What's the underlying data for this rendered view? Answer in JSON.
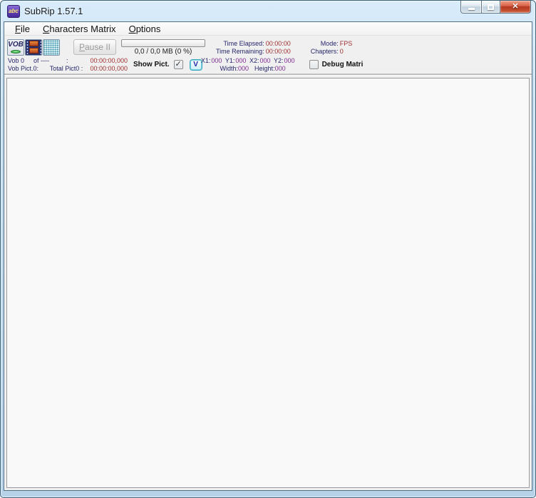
{
  "colors": {
    "label_navy": "#26266b",
    "value_red": "#a03030",
    "value_purple": "#7c2a8e",
    "close_button_red": "#b53922",
    "frame_blue": "#b5d2e9"
  },
  "window": {
    "title": "SubRip 1.57.1",
    "icon_text": "abc"
  },
  "menu": {
    "items": [
      {
        "label": "File"
      },
      {
        "label": "Characters Matrix"
      },
      {
        "label": "Options"
      }
    ]
  },
  "toolbar": {
    "vob_icon_text": "VOB",
    "pause_label": "Pause II",
    "progress_text": "0,0 / 0,0 MB (0 %)",
    "progress_percent": 0,
    "time_elapsed_label": "Time Elapsed:",
    "time_elapsed_value": "00:00:00",
    "time_remaining_label": "Time Remaining:",
    "time_remaining_value": "00:00:00",
    "mode_label": "Mode:",
    "mode_value": "FPS",
    "chapters_label": "Chapters:",
    "chapters_value": "0"
  },
  "status": {
    "vob_label": "Vob 0",
    "vob_of": "of ----",
    "vob_colon": ":",
    "vob_time": "00:00:00,000",
    "vob_pict_label": "Vob Pict.0:",
    "total_pict_label": "Total Pict0 :",
    "total_pict_time": "00:00:00,000",
    "show_pict_label": "Show Pict.",
    "show_pict_checked": true,
    "checkmark": "✓",
    "v_button_label": "V",
    "x1_label": "X1:",
    "x1_value": "000",
    "y1_label": "Y1:",
    "y1_value": "000",
    "x2_label": "X2:",
    "x2_value": "000",
    "y2_label": "Y2:",
    "y2_value": "000",
    "width_label": "Width:",
    "width_value": "000",
    "height_label": "Height:",
    "height_value": "000",
    "debug_checked": false,
    "debug_label": "Debug Matri"
  },
  "window_controls": {
    "minimize": "minimize",
    "maximize": "maximize",
    "close_glyph": "✕"
  }
}
